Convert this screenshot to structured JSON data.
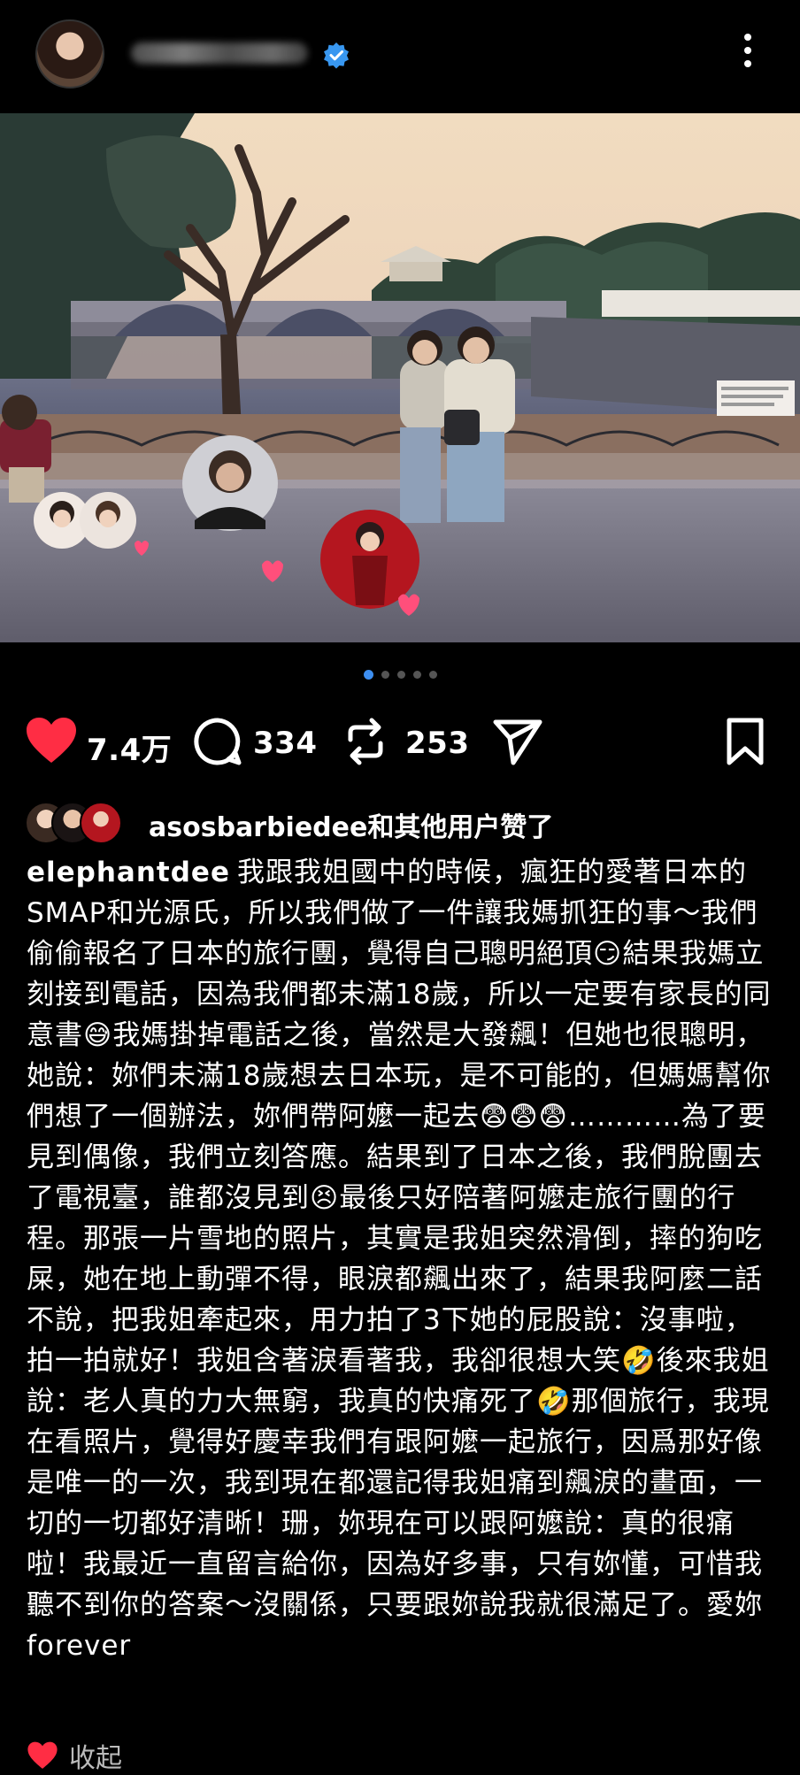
{
  "post": {
    "more_icon": "more-vertical-icon",
    "verified_icon": "verified-badge-icon",
    "carousel_pages": 5,
    "carousel_active": 1
  },
  "actions": {
    "like_count": "7.4万",
    "comment_count": "334",
    "repost_count": "253"
  },
  "liked_by": {
    "text": "asosbarbiedee和其他用户赞了"
  },
  "caption": {
    "username": "elephantdee",
    "text": "我跟我姐國中的時候，瘋狂的愛著日本的SMAP和光源氏，所以我們做了一件讓我媽抓狂的事～我們偷偷報名了日本的旅行團，覺得自己聰明絕頂😏結果我媽立刻接到電話，因為我們都未滿18歲，所以一定要有家長的同意書😅我媽掛掉電話之後，當然是大發飆！但她也很聰明，她說：妳們未滿18歲想去日本玩，是不可能的，但媽媽幫你們想了一個辦法，妳們帶阿嬤一起去😨😨😨…………為了要見到偶像，我們立刻答應。結果到了日本之後，我們脫團去了電視臺，誰都沒見到😣最後只好陪著阿嬤走旅行團的行程。那張一片雪地的照片，其實是我姐突然滑倒，摔的狗吃屎，她在地上動彈不得，眼淚都飆出來了，結果我阿麼二話不說，把我姐牽起來，用力拍了3下她的屁股說：沒事啦，拍一拍就好！我姐含著淚看著我，我卻很想大笑🤣後來我姐說：老人真的力大無窮，我真的快痛死了🤣那個旅行，我現在看照片，覺得好慶幸我們有跟阿嬤一起旅行，因爲那好像是唯一的一次，我到現在都還記得我姐痛到飆淚的畫面，一切的一切都好清晰！珊，妳現在可以跟阿嬤說：真的很痛啦！我最近一直留言給你，因為好多事，只有妳懂，可惜我聽不到你的答案～沒關係，只要跟妳說我就很滿足了。愛妳 forever"
  },
  "collapse": {
    "label": "收起",
    "icon": "heart-icon"
  },
  "colors": {
    "like_red": "#ff2d44",
    "active_dot": "#3d8ef0",
    "verified_blue": "#3897f0"
  }
}
